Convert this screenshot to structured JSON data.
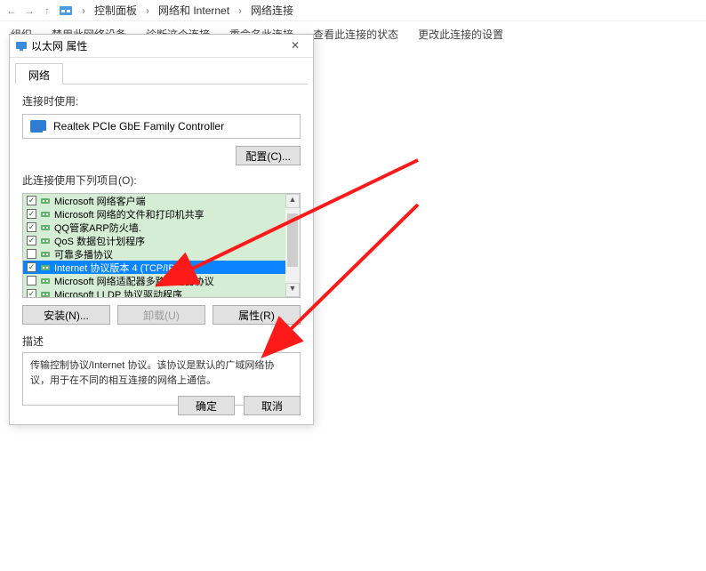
{
  "breadcrumb": {
    "items": [
      "控制面板",
      "网络和 Internet",
      "网络连接"
    ]
  },
  "toolbar": {
    "items": [
      "组织",
      "禁用此网络设备",
      "诊断这个连接",
      "重命名此连接",
      "查看此连接的状态",
      "更改此连接的设置"
    ]
  },
  "dialog": {
    "title": "以太网 属性",
    "tab_label": "网络",
    "connect_using_label": "连接时使用:",
    "adapter_name": "Realtek PCIe GbE Family Controller",
    "configure_btn": "配置(C)...",
    "items_label": "此连接使用下列项目(O):",
    "list": [
      {
        "name": "Microsoft 网络客户端",
        "checked": true,
        "selected": false
      },
      {
        "name": "Microsoft 网络的文件和打印机共享",
        "checked": true,
        "selected": false
      },
      {
        "name": "QQ管家ARP防火墙.",
        "checked": true,
        "selected": false
      },
      {
        "name": "QoS 数据包计划程序",
        "checked": true,
        "selected": false
      },
      {
        "name": "可靠多播协议",
        "checked": false,
        "selected": false
      },
      {
        "name": "Internet 协议版本 4 (TCP/IPv4)",
        "checked": true,
        "selected": true
      },
      {
        "name": "Microsoft 网络适配器多路传送器协议",
        "checked": false,
        "selected": false
      },
      {
        "name": "Microsoft LLDP 协议驱动程序",
        "checked": true,
        "selected": false
      }
    ],
    "install_btn": "安装(N)...",
    "uninstall_btn": "卸载(U)",
    "properties_btn": "属性(R)",
    "desc_label": "描述",
    "desc_text": "传输控制协议/Internet 协议。该协议是默认的广域网络协议，用于在不同的相互连接的网络上通信。",
    "ok_btn": "确定",
    "cancel_btn": "取消"
  },
  "chk_glyph": "✓"
}
